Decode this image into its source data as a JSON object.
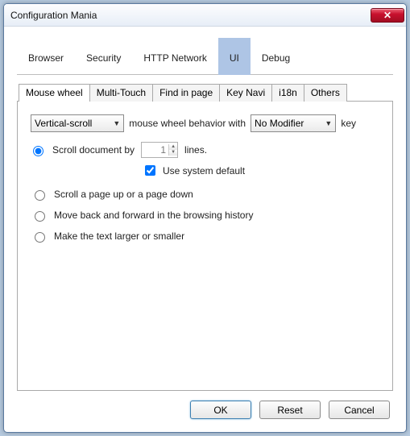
{
  "window": {
    "title": "Configuration Mania"
  },
  "main_tabs": [
    "Browser",
    "Security",
    "HTTP Network",
    "UI",
    "Debug"
  ],
  "main_tab_active_index": 3,
  "sub_tabs": [
    "Mouse wheel",
    "Multi-Touch",
    "Find in page",
    "Key Navi",
    "i18n",
    "Others"
  ],
  "sub_tab_active_index": 0,
  "scroll_direction": {
    "selected": "Vertical-scroll"
  },
  "behavior_text_mid": "mouse wheel behavior with",
  "modifier": {
    "selected": "No Modifier"
  },
  "key_suffix": "key",
  "radio_options": [
    "Scroll document by",
    "Scroll a page up or a page down",
    "Move back and forward in the browsing history",
    "Make the text larger or smaller"
  ],
  "radio_selected_index": 0,
  "scroll_lines_value": "1",
  "lines_suffix": "lines.",
  "use_system_default_label": "Use system default",
  "use_system_default_checked": true,
  "buttons": {
    "ok": "OK",
    "reset": "Reset",
    "cancel": "Cancel"
  }
}
